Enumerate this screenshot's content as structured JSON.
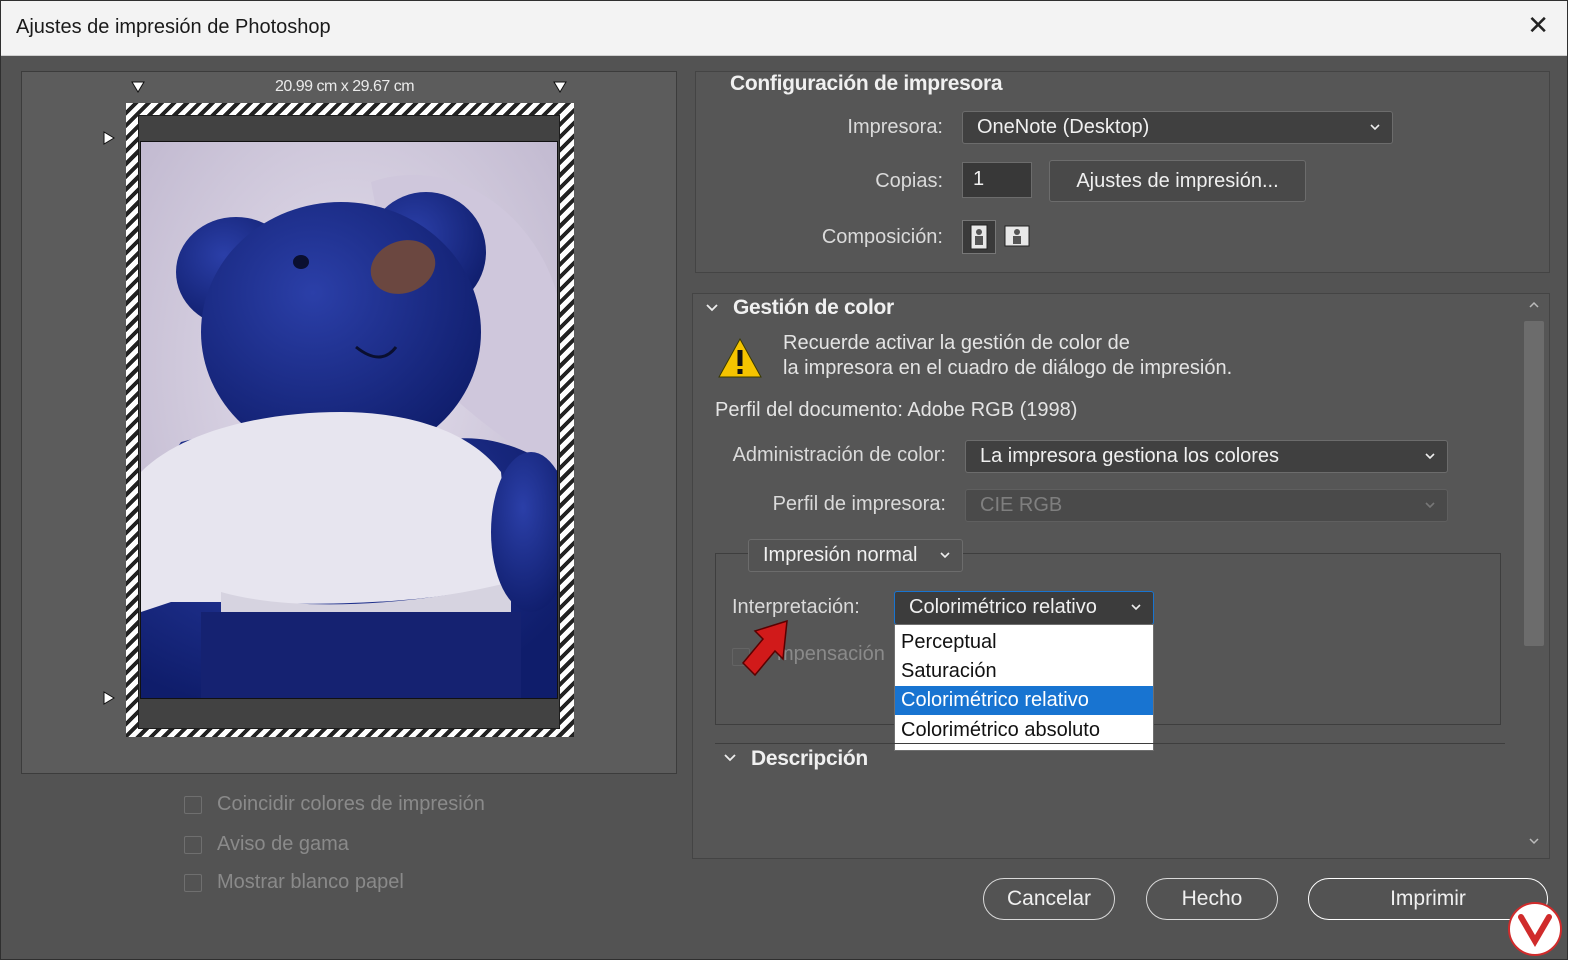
{
  "window": {
    "title": "Ajustes de impresión de Photoshop",
    "close_glyph": "✕"
  },
  "preview": {
    "dimensions": "20.99 cm x 29.67 cm"
  },
  "options": {
    "match_colors": "Coincidir colores de impresión",
    "gamut_warning": "Aviso de gama",
    "show_paper_white": "Mostrar blanco papel"
  },
  "printer_setup": {
    "heading": "Configuración de impresora",
    "printer_label": "Impresora:",
    "printer_value": "OneNote (Desktop)",
    "copies_label": "Copias:",
    "copies_value": "1",
    "print_settings_button": "Ajustes de impresión...",
    "layout_label": "Composición:"
  },
  "color_management": {
    "heading": "Gestión de color",
    "warning_line1": "Recuerde activar la gestión de color de",
    "warning_line2": "la impresora en el cuadro de diálogo de impresión.",
    "document_profile": "Perfil del documento: Adobe RGB (1998)",
    "color_handling_label": "Administración de color:",
    "color_handling_value": "La impresora gestiona los colores",
    "printer_profile_label": "Perfil de impresora:",
    "printer_profile_value": "CIE RGB",
    "print_mode_value": "Impresión normal",
    "rendering_label": "Interpretación:",
    "rendering_value": "Colorimétrico relativo",
    "bpc_label_partial": "mpensación",
    "rendering_options": [
      "Perceptual",
      "Saturación",
      "Colorimétrico relativo",
      "Colorimétrico absoluto"
    ],
    "selected_option_index": 2
  },
  "description": {
    "heading": "Descripción"
  },
  "footer": {
    "cancel": "Cancelar",
    "done": "Hecho",
    "print": "Imprimir"
  },
  "colors": {
    "selection": "#1874d1",
    "dialog_bg": "#535353",
    "arrow": "#d11a1a"
  }
}
